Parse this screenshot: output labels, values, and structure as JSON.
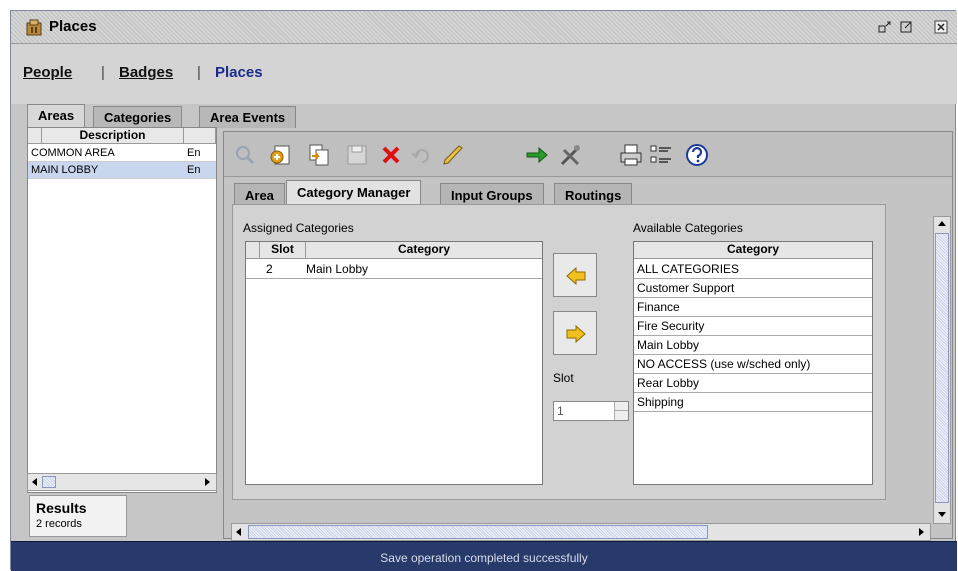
{
  "window": {
    "title": "Places"
  },
  "nav": {
    "people": "People",
    "badges": "Badges",
    "places": "Places",
    "sep": "|"
  },
  "top_tabs": [
    "Areas",
    "Categories",
    "Area Events"
  ],
  "areas_grid": {
    "header_description": "Description",
    "rows": [
      {
        "description": "COMMON AREA",
        "extra": "En"
      },
      {
        "description": "MAIN LOBBY",
        "extra": "En"
      }
    ]
  },
  "results": {
    "title": "Results",
    "count": "2 records"
  },
  "inner_tabs": [
    "Area",
    "Category Manager",
    "Input Groups",
    "Routings"
  ],
  "category_manager": {
    "assigned_label": "Assigned Categories",
    "assigned_header_slot": "Slot",
    "assigned_header_category": "Category",
    "assigned_rows": [
      {
        "slot": "2",
        "category": "Main Lobby"
      }
    ],
    "available_label": "Available Categories",
    "available_header": "Category",
    "available_rows": [
      "ALL CATEGORIES",
      "Customer Support",
      "Finance",
      "Fire Security",
      "Main Lobby",
      "NO ACCESS (use w/sched only)",
      "Rear Lobby",
      "Shipping"
    ],
    "slot_label": "Slot",
    "slot_value": "1"
  },
  "status": {
    "message": "Save operation completed successfully"
  },
  "colors": {
    "status_bg": "#273a6a",
    "nav_active": "#1a2b8a",
    "arrow": "#f0c020"
  }
}
